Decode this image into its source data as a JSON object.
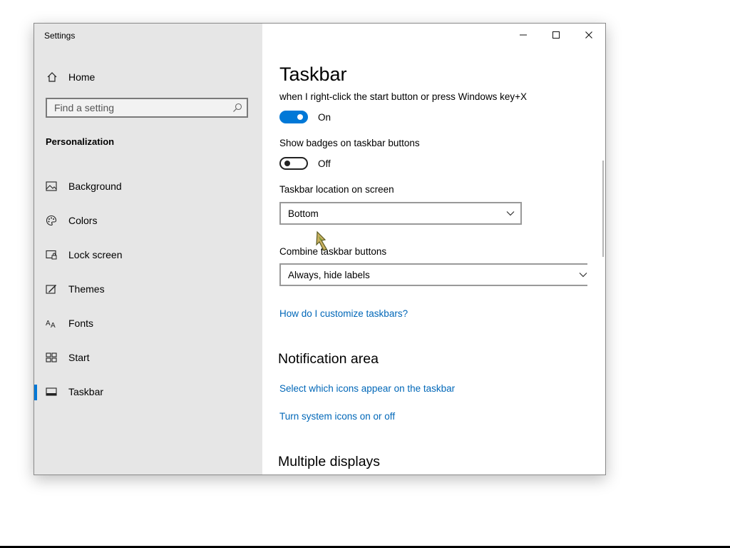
{
  "window": {
    "title": "Settings"
  },
  "sidebar": {
    "home_label": "Home",
    "search_placeholder": "Find a setting",
    "category": "Personalization",
    "items": [
      {
        "label": "Background",
        "icon": "picture-icon"
      },
      {
        "label": "Colors",
        "icon": "palette-icon"
      },
      {
        "label": "Lock screen",
        "icon": "lock-screen-icon"
      },
      {
        "label": "Themes",
        "icon": "themes-icon"
      },
      {
        "label": "Fonts",
        "icon": "fonts-icon"
      },
      {
        "label": "Start",
        "icon": "start-icon"
      },
      {
        "label": "Taskbar",
        "icon": "taskbar-icon",
        "active": true
      }
    ]
  },
  "main": {
    "title": "Taskbar",
    "peek_text": "when I right-click the start button or press Windows key+X",
    "peek_toggle": {
      "state": "On",
      "on": true
    },
    "badges": {
      "label": "Show badges on taskbar buttons",
      "state": "Off",
      "on": false
    },
    "location": {
      "label": "Taskbar location on screen",
      "value": "Bottom"
    },
    "combine": {
      "label": "Combine taskbar buttons",
      "value": "Always, hide labels"
    },
    "customize_link": "How do I customize taskbars?",
    "notification": {
      "heading": "Notification area",
      "link1": "Select which icons appear on the taskbar",
      "link2": "Turn system icons on or off"
    },
    "multiple_heading": "Multiple displays"
  },
  "colors": {
    "accent": "#0078d7",
    "link": "#0067b8",
    "sidebar_bg": "#e6e6e6"
  }
}
